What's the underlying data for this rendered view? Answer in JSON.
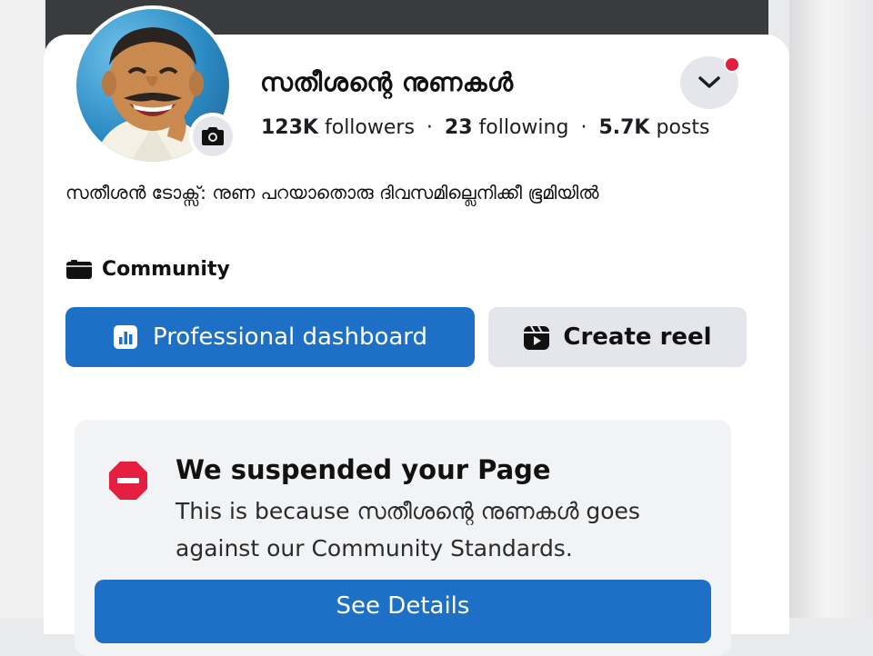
{
  "page": {
    "name": "സതീശന്റെ നുണകൾ",
    "stats": {
      "followers_count": "123K",
      "followers_label": "followers",
      "following_count": "23",
      "following_label": "following",
      "posts_count": "5.7K",
      "posts_label": "posts",
      "separator": "·"
    },
    "bio": "സതീശൻ ടോക്സ്: നുണ പറയാതൊരു ദിവസമില്ലെനിക്കീ ഭൂമിയിൽ",
    "category": "Community"
  },
  "actions": {
    "professional_dashboard": "Professional dashboard",
    "create_reel": "Create reel"
  },
  "suspension": {
    "title": "We suspended your Page",
    "body": "This is because സതീശന്റെ നുണകൾ goes against our Community Standards.",
    "see_details": "See Details"
  },
  "icons": {
    "camera": "camera-icon",
    "chevron": "chevron-down-icon",
    "category": "category-icon",
    "dashboard": "bar-chart-icon",
    "reel": "reel-icon",
    "alert": "no-entry-icon"
  },
  "colors": {
    "primary": "#1e6fc6",
    "alert": "#e41e3f",
    "secondary_bg": "#e4e6eb",
    "card_bg": "#f2f3f5"
  }
}
